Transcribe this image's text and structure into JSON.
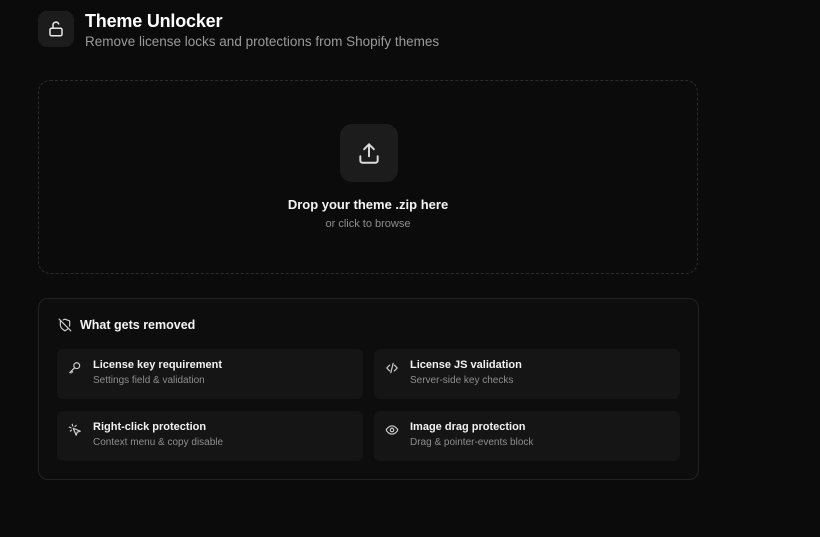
{
  "header": {
    "title": "Theme Unlocker",
    "subtitle": "Remove license locks and protections from Shopify themes",
    "icon": "unlock-icon"
  },
  "dropzone": {
    "title": "Drop your theme .zip here",
    "subtitle": "or click to browse",
    "icon": "upload-icon"
  },
  "removed": {
    "title": "What gets removed",
    "icon": "shield-off-icon",
    "items": [
      {
        "title": "License key requirement",
        "subtitle": "Settings field & validation",
        "icon": "key-icon"
      },
      {
        "title": "License JS validation",
        "subtitle": "Server-side key checks",
        "icon": "code-icon"
      },
      {
        "title": "Right-click protection",
        "subtitle": "Context menu & copy disable",
        "icon": "cursor-click-icon"
      },
      {
        "title": "Image drag protection",
        "subtitle": "Drag & pointer-events block",
        "icon": "eye-icon"
      }
    ]
  },
  "colors": {
    "background": "#0b0b0b",
    "card": "#151515",
    "text": "#f2f2f2",
    "muted": "#8e8e8e"
  }
}
